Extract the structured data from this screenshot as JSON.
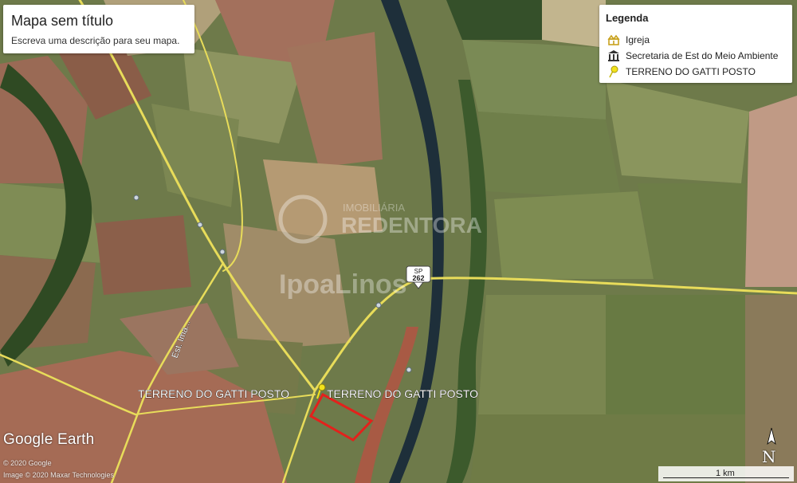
{
  "title_panel": {
    "title": "Mapa sem título",
    "description": "Escreva uma descrição para seu mapa."
  },
  "legend": {
    "heading": "Legenda",
    "items": [
      {
        "label": "Igreja",
        "icon": "church-icon",
        "color": "#c8a21e"
      },
      {
        "label": "Secretaria de Est do Meio Ambiente",
        "icon": "government-building-icon",
        "color": "#333333"
      },
      {
        "label": "TERRENO DO GATTI POSTO",
        "icon": "yellow-pushpin-icon",
        "color": "#f2e21b"
      }
    ]
  },
  "map": {
    "placemark_labels": [
      "TERRENO DO GATTI POSTO",
      "TERRENO DO GATTI POSTO"
    ],
    "road_shield": {
      "top": "SP",
      "number": "262"
    },
    "street_label": "Est. Ima...",
    "watermark_1": "IMOBILIÁRIA",
    "watermark_2": "REDENTORA",
    "watermark_3": "IpoaLinos",
    "brand": "Google Earth",
    "copyright_1": "© 2020 Google",
    "copyright_2": "Image © 2020 Maxar Technologies",
    "scale_label": "1 km",
    "compass_letter": "N",
    "plot_outline_color": "#e3211c",
    "road_color": "#e8dc5a"
  }
}
